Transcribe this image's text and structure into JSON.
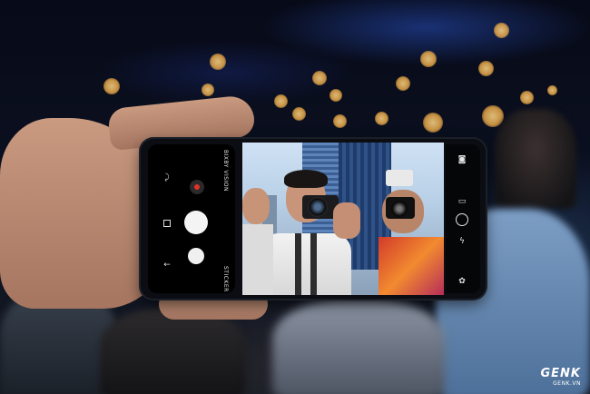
{
  "phone_ui": {
    "side_labels": {
      "top": "BIXBY VISION",
      "bottom": "STICKER"
    },
    "icons": {
      "flip": "flip-camera-icon",
      "record": "record-icon",
      "shutter": "shutter-button",
      "secondary": "secondary-shutter",
      "recent": "recent-apps-icon",
      "back": "back-icon",
      "camera": "camera-icon",
      "tag": "tag-icon",
      "dial": "dial-icon",
      "flash": "flash-off-icon",
      "settings": "settings-icon"
    },
    "colors": {
      "record": "#e0322a"
    }
  },
  "watermark": {
    "brand": "GENK",
    "domain": "GENK.VN"
  }
}
